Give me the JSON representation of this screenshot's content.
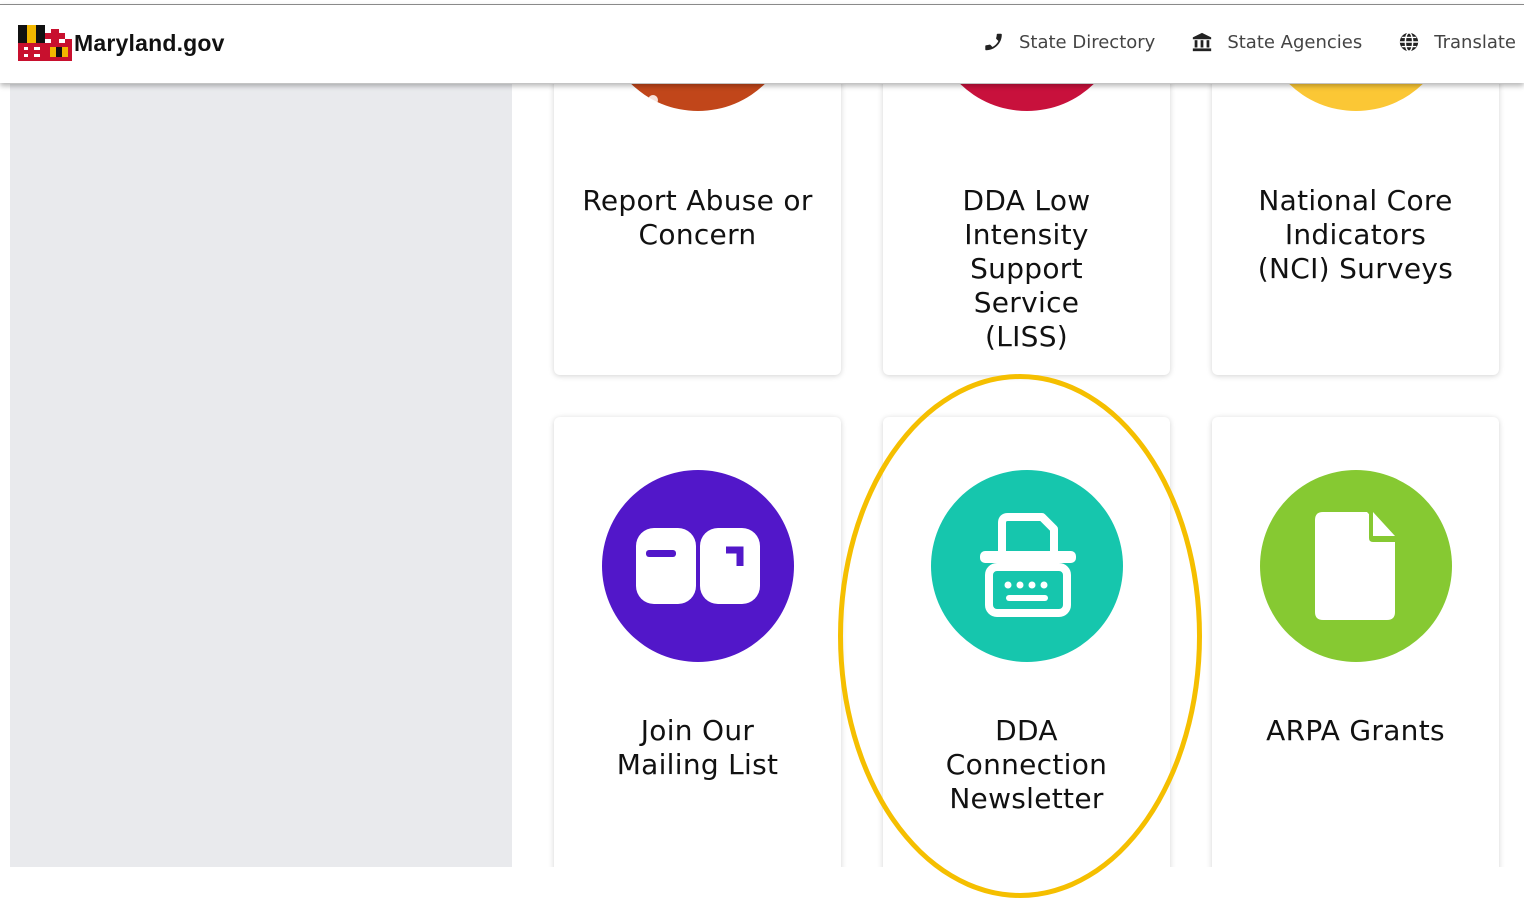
{
  "header": {
    "brand": "Maryland.gov",
    "nav": [
      {
        "label": "State Directory",
        "icon": "phone-icon"
      },
      {
        "label": "State Agencies",
        "icon": "building-icon"
      },
      {
        "label": "Translate",
        "icon": "globe-icon"
      }
    ]
  },
  "cards_row1": [
    {
      "label": "Report Abuse or Concern",
      "color": "#c1461a"
    },
    {
      "label": "DDA Low Intensity Support Service (LISS)",
      "color": "#c8113c"
    },
    {
      "label": "National Core Indicators (NCI) Surveys",
      "color": "#fbc735"
    }
  ],
  "cards_row2": [
    {
      "label": "Join Our Mailing List",
      "color": "#5217c9",
      "icon": "mailbox-icon"
    },
    {
      "label": "DDA Connection Newsletter",
      "color": "#16c6ad",
      "icon": "typewriter-icon"
    },
    {
      "label": "ARPA Grants",
      "color": "#86c932",
      "icon": "document-icon"
    }
  ],
  "colors": {
    "highlight": "#f5bf00",
    "sidebar": "#e9eaed"
  }
}
